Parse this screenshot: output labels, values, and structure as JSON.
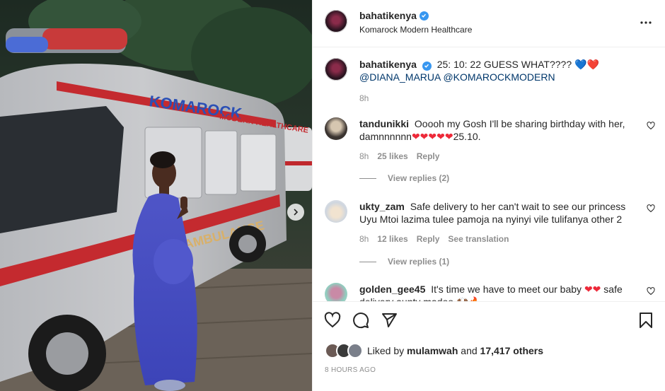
{
  "post": {
    "username": "bahatikenya",
    "location": "Komarock Modern Healthcare",
    "more_icon": "more-horizontal-icon"
  },
  "photo": {
    "van_brand": "KOMAROCK",
    "van_brand2": "MODERN HEALTHCARE",
    "van_side": "AMBULANCE",
    "next_icon": "chevron-right-icon"
  },
  "caption": {
    "username": "bahatikenya",
    "text": "25: 10: 22 GUESS WHAT????",
    "emoji": [
      "💙",
      "❤️"
    ],
    "mentions": "@DIANA_MARUA @KOMAROCKMODERN",
    "time": "8h"
  },
  "comments": [
    {
      "username": "tandunikki",
      "text": "Ooooh my Gosh I'll be sharing birthday with her, damnnnnnn",
      "hearts": "❤❤❤❤❤",
      "tail": "25.10.",
      "time": "8h",
      "likes": "25 likes",
      "reply": "Reply",
      "view_replies": "View replies (2)"
    },
    {
      "username": "ukty_zam",
      "text": "Safe delivery to her can't wait to see our princess Uyu Mtoi lazima tulee pamoja na nyinyi vile tulifanya other 2",
      "time": "8h",
      "likes": "12 likes",
      "reply": "Reply",
      "translate": "See translation",
      "view_replies": "View replies (1)"
    },
    {
      "username": "golden_gee45",
      "text": "It's time we have to meet our baby",
      "hearts": "❤❤",
      "tail": "safe delivery aunty madoo 🙌🏾🔥"
    }
  ],
  "likes": {
    "prefix": "Liked by",
    "user": "mulamwah",
    "and": "and",
    "count": "17,417 others"
  },
  "timestamp": "8 HOURS AGO",
  "colors": {
    "verified": "#3897f0",
    "mention": "#00376b",
    "muted": "#8e8e8e",
    "heart": "#ed2939"
  }
}
